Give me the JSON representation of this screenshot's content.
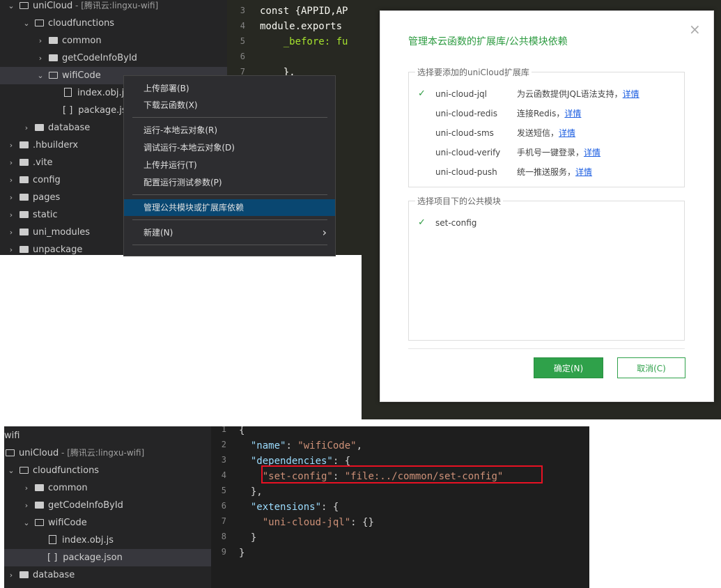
{
  "top_explorer": {
    "project": {
      "name": "uniCloud",
      "suffix": " - [腾讯云:lingxu-wifi]"
    },
    "items": [
      {
        "label": "cloudfunctions"
      },
      {
        "label": "common"
      },
      {
        "label": "getCodeInfoById"
      },
      {
        "label": "wifiCode"
      },
      {
        "label": "index.obj.js"
      },
      {
        "label": "package.json"
      },
      {
        "label": "database"
      },
      {
        "label": ".hbuilderx"
      },
      {
        "label": ".vite"
      },
      {
        "label": "config"
      },
      {
        "label": "pages"
      },
      {
        "label": "static"
      },
      {
        "label": "uni_modules"
      },
      {
        "label": "unpackage"
      }
    ],
    "bracket_icon": "[ ]"
  },
  "top_editor": {
    "line_numbers": [
      "3",
      "4",
      "5",
      "6",
      "7"
    ],
    "lines": [
      "const {APPID,AP",
      "module.exports",
      "    _before: fu",
      "",
      "    },"
    ]
  },
  "context_menu": {
    "items": [
      {
        "label": "上传部署(B)"
      },
      {
        "label": "下载云函数(X)"
      },
      {
        "label": "运行-本地云对象(R)"
      },
      {
        "label": "调试运行-本地云对象(D)"
      },
      {
        "label": "上传并运行(T)"
      },
      {
        "label": "配置运行测试参数(P)"
      },
      {
        "label": "管理公共模块或扩展库依赖"
      },
      {
        "label": "新建(N)"
      }
    ],
    "submenu_arrow": "›"
  },
  "dialog": {
    "title": "管理本云函数的扩展库/公共模块依赖",
    "close_glyph": "×",
    "ext_group_label": "选择要添加的uniCloud扩展库",
    "ext_libs": [
      {
        "name": "uni-cloud-jql",
        "desc": "为云函数提供JQL语法支持，",
        "link": "详情",
        "checked": true
      },
      {
        "name": "uni-cloud-redis",
        "desc": "连接Redis，",
        "link": "详情",
        "checked": false
      },
      {
        "name": "uni-cloud-sms",
        "desc": "发送短信，",
        "link": "详情",
        "checked": false
      },
      {
        "name": "uni-cloud-verify",
        "desc": "手机号一键登录，",
        "link": "详情",
        "checked": false
      },
      {
        "name": "uni-cloud-push",
        "desc": "统一推送服务，",
        "link": "详情",
        "checked": false
      }
    ],
    "module_group_label": "选择项目下的公共模块",
    "modules": [
      {
        "name": "set-config",
        "checked": true
      }
    ],
    "check_glyph": "✓",
    "ok_label": "确定(N)",
    "cancel_label": "取消(C)"
  },
  "bottom_explorer": {
    "root": "wifi",
    "project": {
      "name": "uniCloud",
      "suffix": " - [腾讯云:lingxu-wifi]"
    },
    "items": [
      {
        "label": "cloudfunctions"
      },
      {
        "label": "common"
      },
      {
        "label": "getCodeInfoById"
      },
      {
        "label": "wifiCode"
      },
      {
        "label": "index.obj.js"
      },
      {
        "label": "package.json"
      },
      {
        "label": "database"
      }
    ],
    "bracket_icon": "[ ]"
  },
  "bottom_editor": {
    "line_numbers": [
      "1",
      "2",
      "3",
      "4",
      "5",
      "6",
      "7",
      "8",
      "9"
    ],
    "lines": [
      {
        "parts": [
          {
            "t": "{",
            "c": ""
          }
        ]
      },
      {
        "parts": [
          {
            "t": "  ",
            "c": ""
          },
          {
            "t": "\"name\"",
            "c": "k"
          },
          {
            "t": ": ",
            "c": ""
          },
          {
            "t": "\"wifiCode\"",
            "c": "s"
          },
          {
            "t": ",",
            "c": ""
          }
        ]
      },
      {
        "parts": [
          {
            "t": "  ",
            "c": ""
          },
          {
            "t": "\"dependencies\"",
            "c": "k"
          },
          {
            "t": ": {",
            "c": ""
          }
        ]
      },
      {
        "parts": [
          {
            "t": "    ",
            "c": ""
          },
          {
            "t": "\"set-config\"",
            "c": "s"
          },
          {
            "t": ": ",
            "c": ""
          },
          {
            "t": "\"file:../common/set-config\"",
            "c": "s"
          }
        ]
      },
      {
        "parts": [
          {
            "t": "  },",
            "c": ""
          }
        ]
      },
      {
        "parts": [
          {
            "t": "  ",
            "c": ""
          },
          {
            "t": "\"extensions\"",
            "c": "k"
          },
          {
            "t": ": {",
            "c": ""
          }
        ]
      },
      {
        "parts": [
          {
            "t": "    ",
            "c": ""
          },
          {
            "t": "\"uni-cloud-jql\"",
            "c": "s"
          },
          {
            "t": ": {}",
            "c": ""
          }
        ]
      },
      {
        "parts": [
          {
            "t": "  }",
            "c": ""
          }
        ]
      },
      {
        "parts": [
          {
            "t": "}",
            "c": ""
          }
        ]
      }
    ]
  },
  "colors": {
    "accent_green": "#2fa14a",
    "highlight_box": "#e81123",
    "menu_highlight": "#094771"
  }
}
